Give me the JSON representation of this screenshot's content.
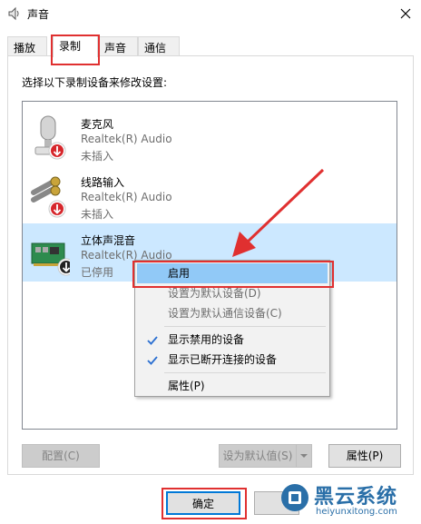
{
  "window": {
    "title": "声音",
    "icon": "speaker-icon",
    "close": "close-icon"
  },
  "tabs": [
    {
      "label": "播放"
    },
    {
      "label": "录制"
    },
    {
      "label": "声音"
    },
    {
      "label": "通信"
    }
  ],
  "instruction": "选择以下录制设备来修改设置:",
  "devices": [
    {
      "name": "麦克风",
      "driver": "Realtek(R) Audio",
      "status": "未插入",
      "icon": "microphone-icon"
    },
    {
      "name": "线路输入",
      "driver": "Realtek(R) Audio",
      "status": "未插入",
      "icon": "line-in-icon"
    },
    {
      "name": "立体声混音",
      "driver": "Realtek(R) Audio",
      "status": "已停用",
      "icon": "sound-card-icon"
    }
  ],
  "context_menu": {
    "items": [
      {
        "label": "启用"
      },
      {
        "label": "设置为默认设备(D)"
      },
      {
        "label": "设置为默认通信设备(C)"
      },
      {
        "label": "显示禁用的设备",
        "checked": true
      },
      {
        "label": "显示已断开连接的设备",
        "checked": true
      },
      {
        "label": "属性(P)"
      }
    ]
  },
  "buttons": {
    "configure": "配置(C)",
    "set_default": "设为默认值(S)",
    "properties": "属性(P)",
    "ok": "确定"
  },
  "watermark": {
    "title": "黑云系统",
    "url": "heiyunxitong.com"
  },
  "colors": {
    "highlight_red": "#e03030",
    "selection": "#cce8ff",
    "menu_hover": "#91c9f7",
    "accent": "#0078d7"
  }
}
